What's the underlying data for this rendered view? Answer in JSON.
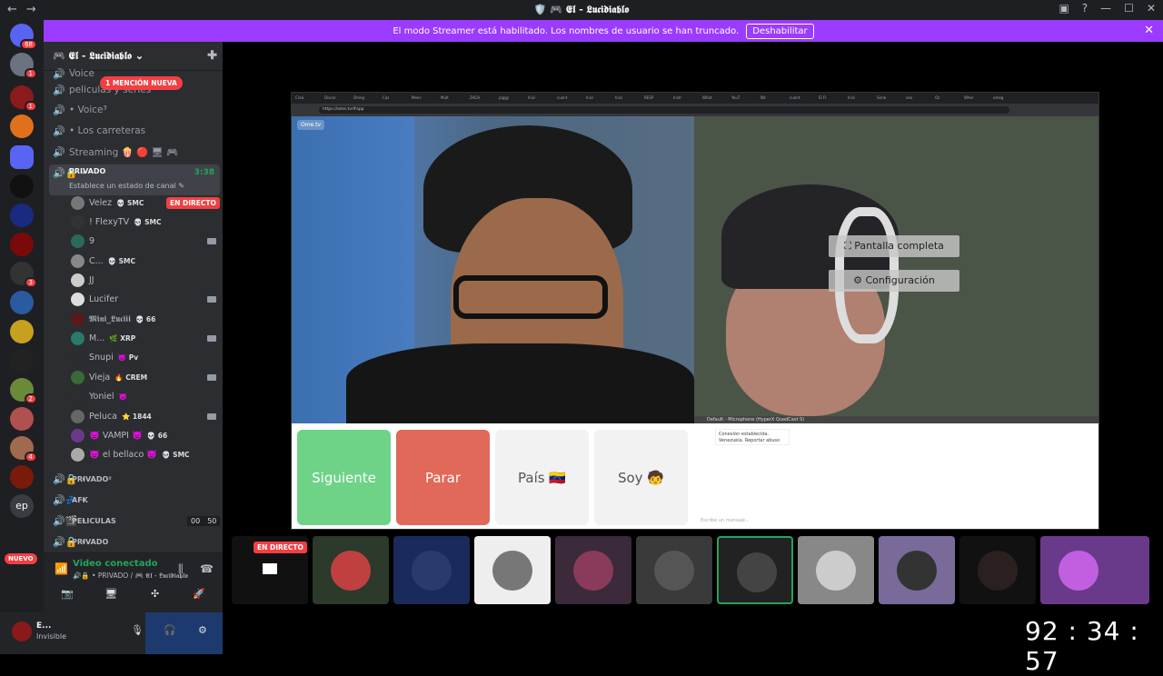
{
  "window": {
    "title": "🛡️ 🎮 𝕰𝖑 - 𝕷𝖚𝖈𝖎𝖉𝖎𝖆𝖇𝖑𝖔",
    "back": "←",
    "forward": "→",
    "controls": [
      "▣",
      "?",
      "—",
      "☐",
      "✕"
    ]
  },
  "banner": {
    "text": "El modo Streamer está habilitado. Los nombres de usuario se han truncado.",
    "button": "Deshabilitar",
    "close": "✕"
  },
  "servers": {
    "badges": [
      "68",
      "1",
      "1",
      "1",
      "3",
      "2",
      "4"
    ],
    "ep_label": "ep",
    "nuevo": "NUEVO"
  },
  "guild": {
    "name": "🎮 𝕰𝖑 - 𝕷𝖚𝖈𝖎𝖉𝖎𝖆𝖇𝖑𝖔",
    "chevron": "⌄",
    "add_icon": "✚"
  },
  "mention_pill": "1 MENCIÓN NUEVA",
  "channels": [
    {
      "label": "Voice",
      "icon": "🔊"
    },
    {
      "label": "peliculas y series",
      "icon": "🔊"
    },
    {
      "label": "• Voice³",
      "prefix": "🔊",
      "icon": "🔊"
    },
    {
      "label": "• Los carreteras",
      "prefix": "🔊",
      "icon": "🔊"
    },
    {
      "label": "Streaming 🍿 🔴 🖥 🎮",
      "icon": "🔊"
    }
  ],
  "active_channel": {
    "label": "PRIVADO",
    "prefix": "🔊🔒 •",
    "time": "3:38",
    "sub": "Establece un estado de canal ✎"
  },
  "users": [
    {
      "name": "Velez",
      "extra": "💀 SMC",
      "live": "EN DIRECTO"
    },
    {
      "name": "! FlexyTV",
      "extra": "💀 SMC"
    },
    {
      "name": "9",
      "extra": ""
    },
    {
      "name": "C...",
      "extra": "💀 SMC"
    },
    {
      "name": "JJ",
      "extra": ""
    },
    {
      "name": "Lucifer",
      "extra": ""
    },
    {
      "name": "𝕸𝖎𝖓𝖎_𝕷𝖚𝖈𝖎𝖎𝖎",
      "extra": "💀 66"
    },
    {
      "name": "M...",
      "extra": "🌿 XRP"
    },
    {
      "name": "Snupi",
      "extra": "👿 Pv"
    },
    {
      "name": "Vieja",
      "extra": "🔥 CREM"
    },
    {
      "name": "Yoniel",
      "extra": "👿"
    },
    {
      "name": "Peluca",
      "extra": "⭐ 1844"
    },
    {
      "name": "👿 VAMPI 👿",
      "extra": "💀 66"
    },
    {
      "name": "👿 el bellaco 👿",
      "extra": "💀 SMC"
    }
  ],
  "channels_after": [
    {
      "label": "PRIVADO²",
      "prefix": "🔊🔒 •"
    },
    {
      "label": "AFK",
      "prefix": "🔊💤 •"
    },
    {
      "label": "PELICULAS",
      "prefix": "🔊🎬 •",
      "counts": [
        "00",
        "50"
      ]
    },
    {
      "label": "PRIVADO",
      "prefix": "🔊🔒 •"
    }
  ],
  "voice_panel": {
    "status": "Video conectado",
    "where": "🔊🔒 • PRIVADO / 🎮 𝕰𝖑 - 𝕷𝖚𝖈𝖎𝖉𝖎𝖆𝖇𝖑𝖔",
    "buttons": [
      "📷",
      "🖥",
      "✣",
      "🚀"
    ]
  },
  "user_panel": {
    "name": "E...",
    "status": "Invisible"
  },
  "browser": {
    "tabs": [
      "Crea",
      "Discor",
      "Omeg",
      "Cas",
      "Mens",
      "Mult",
      "ZACH",
      "piggy",
      "Inici",
      "cuent",
      "Inici",
      "Inici",
      "RESP",
      "Instr",
      "What",
      "YouT",
      "Nit",
      "cuent",
      "El Fr",
      "Inici",
      "Serie",
      "sea",
      "Oz",
      "Wher",
      "omeg"
    ],
    "url": "https://ome.tv/#app",
    "logo": "Ome.tv",
    "menu_fullscreen": "⛶ Pantalla completa",
    "menu_settings": "⚙ Configuración",
    "mic": "Default - Microphone (HyperX QuadCast S)",
    "buttons": {
      "next": "Siguiente",
      "stop": "Parar",
      "country": "País 🇻🇪",
      "me": "Soy 🧒"
    },
    "chat_msg_1": "Conexión establecida.",
    "chat_msg_2": "Venezuela. Reportar abuso",
    "chat_placeholder": "Escribe un mensaje..."
  },
  "stream_strip": {
    "live": "EN DIRECTO"
  },
  "timer": "92 : 34 : 57"
}
